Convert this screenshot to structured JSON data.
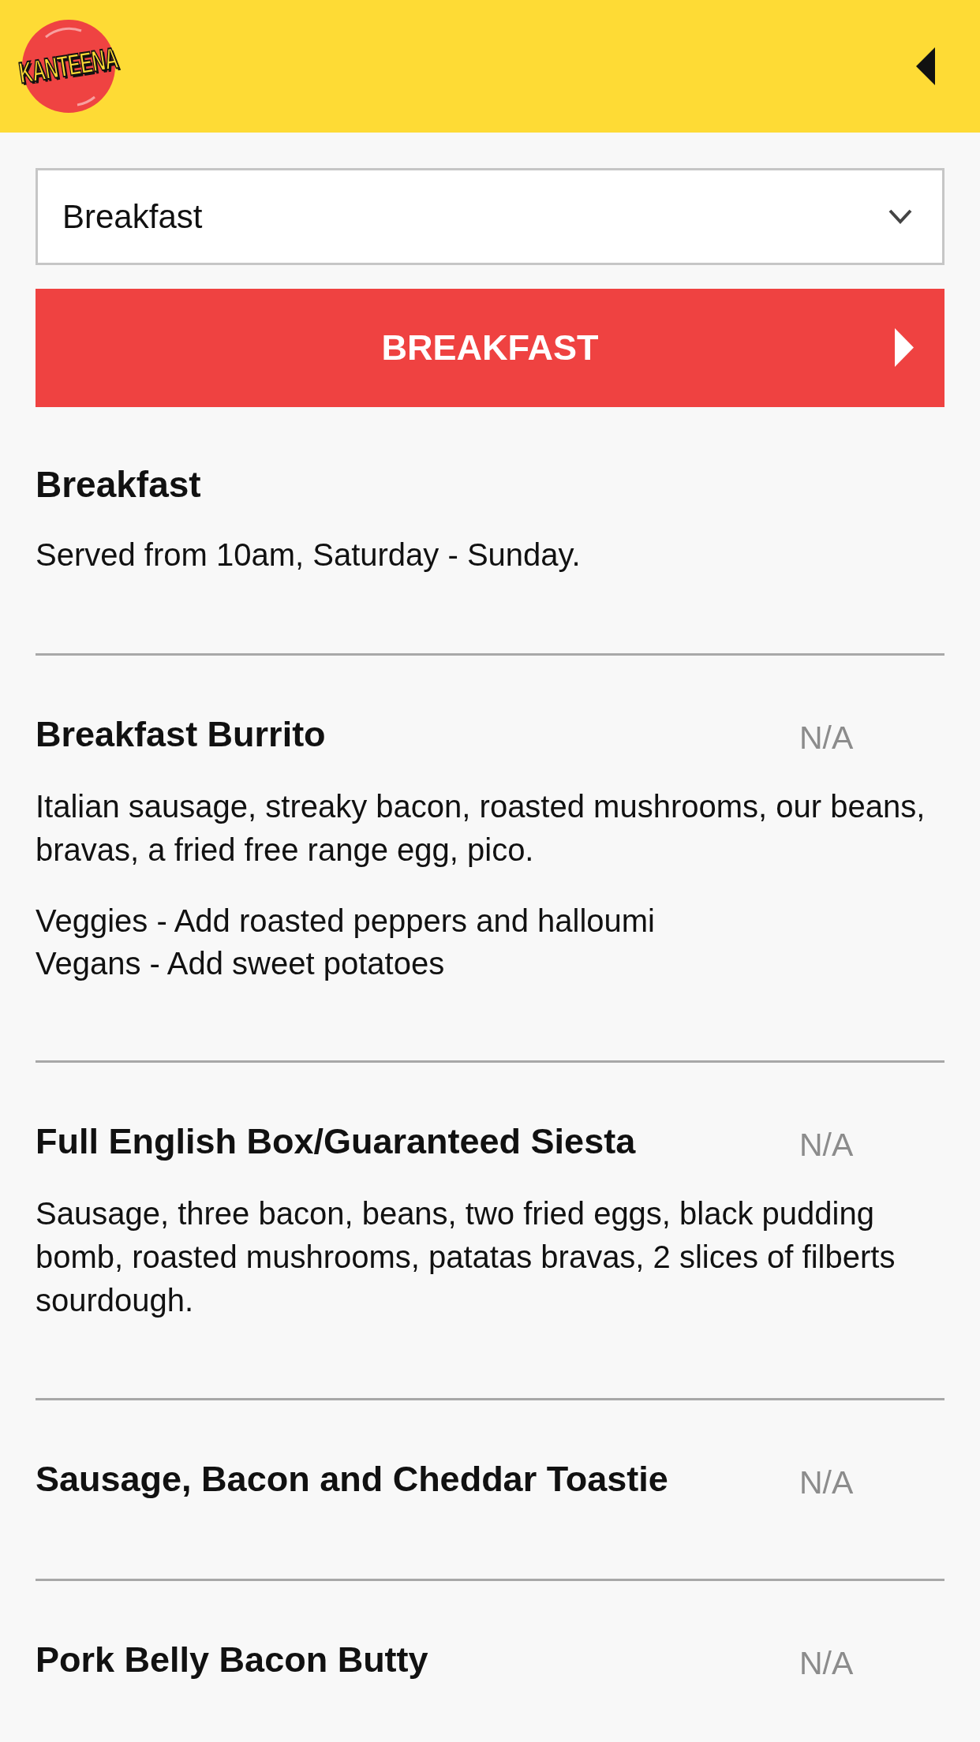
{
  "header": {
    "logo_text": "KANTEENA"
  },
  "category_select": {
    "value": "Breakfast"
  },
  "section_button": {
    "label": "BREAKFAST"
  },
  "section": {
    "title": "Breakfast",
    "description": "Served from 10am, Saturday - Sunday."
  },
  "items": [
    {
      "name": "Breakfast Burrito",
      "price": "N/A",
      "description": "Italian sausage, streaky bacon, roasted mushrooms, our beans, bravas, a fried free range egg, pico.",
      "notes": [
        "Veggies - Add roasted peppers and halloumi",
        "Vegans - Add sweet potatoes"
      ]
    },
    {
      "name": "Full English Box/Guaranteed Siesta",
      "price": "N/A",
      "description": "Sausage, three bacon, beans, two fried eggs, black pudding bomb, roasted mushrooms, patatas bravas, 2 slices of filberts sourdough."
    },
    {
      "name": "Sausage, Bacon and Cheddar Toastie",
      "price": "N/A"
    },
    {
      "name": "Pork Belly Bacon Butty",
      "price": "N/A"
    }
  ]
}
